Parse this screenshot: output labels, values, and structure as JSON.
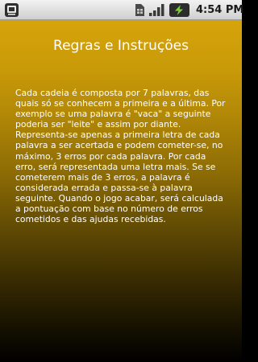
{
  "status_bar": {
    "time": "4:54 PM",
    "icons": [
      "notification-icon",
      "sim-card-icon",
      "signal-icon",
      "battery-charging-icon"
    ]
  },
  "screen": {
    "title": "Regras e Instruções",
    "body": "Cada cadeia é composta por 7 palavras, das quais só se conhecem a primeira e a última. Por exemplo se uma palavra é \"vaca\" a seguinte poderia ser \"leite\" e assim por diante. Representa-se apenas a primeira letra de cada palavra a ser acertada e podem cometer-se, no máximo, 3 erros por cada palavra. Por cada erro, será representada uma letra mais. Se se cometerem mais de 3 erros, a palavra é considerada errada e passa-se à palavra seguinte. Quando o jogo acabar, será calculada a pontuação com base no número de erros cometidos e das ajudas recebidas."
  },
  "colors": {
    "background_top": "#d6a40a",
    "background_bottom": "#000000",
    "text": "#ffffff",
    "status_bar": "#e0e0e0"
  }
}
